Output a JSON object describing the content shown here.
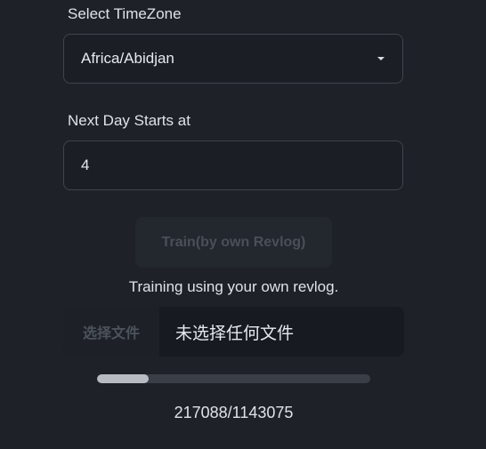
{
  "timezone": {
    "label": "Select TimeZone",
    "selected": "Africa/Abidjan"
  },
  "next_day": {
    "label": "Next Day Starts at",
    "value": "4"
  },
  "train_button": {
    "label": "Train(by own Revlog)"
  },
  "hint_text": "Training using your own revlog.",
  "file_input": {
    "button_label": "选择文件",
    "status": "未选择任何文件"
  },
  "progress": {
    "current": 217088,
    "total": 1143075,
    "fraction": 0.19,
    "text": "217088/1143075"
  }
}
